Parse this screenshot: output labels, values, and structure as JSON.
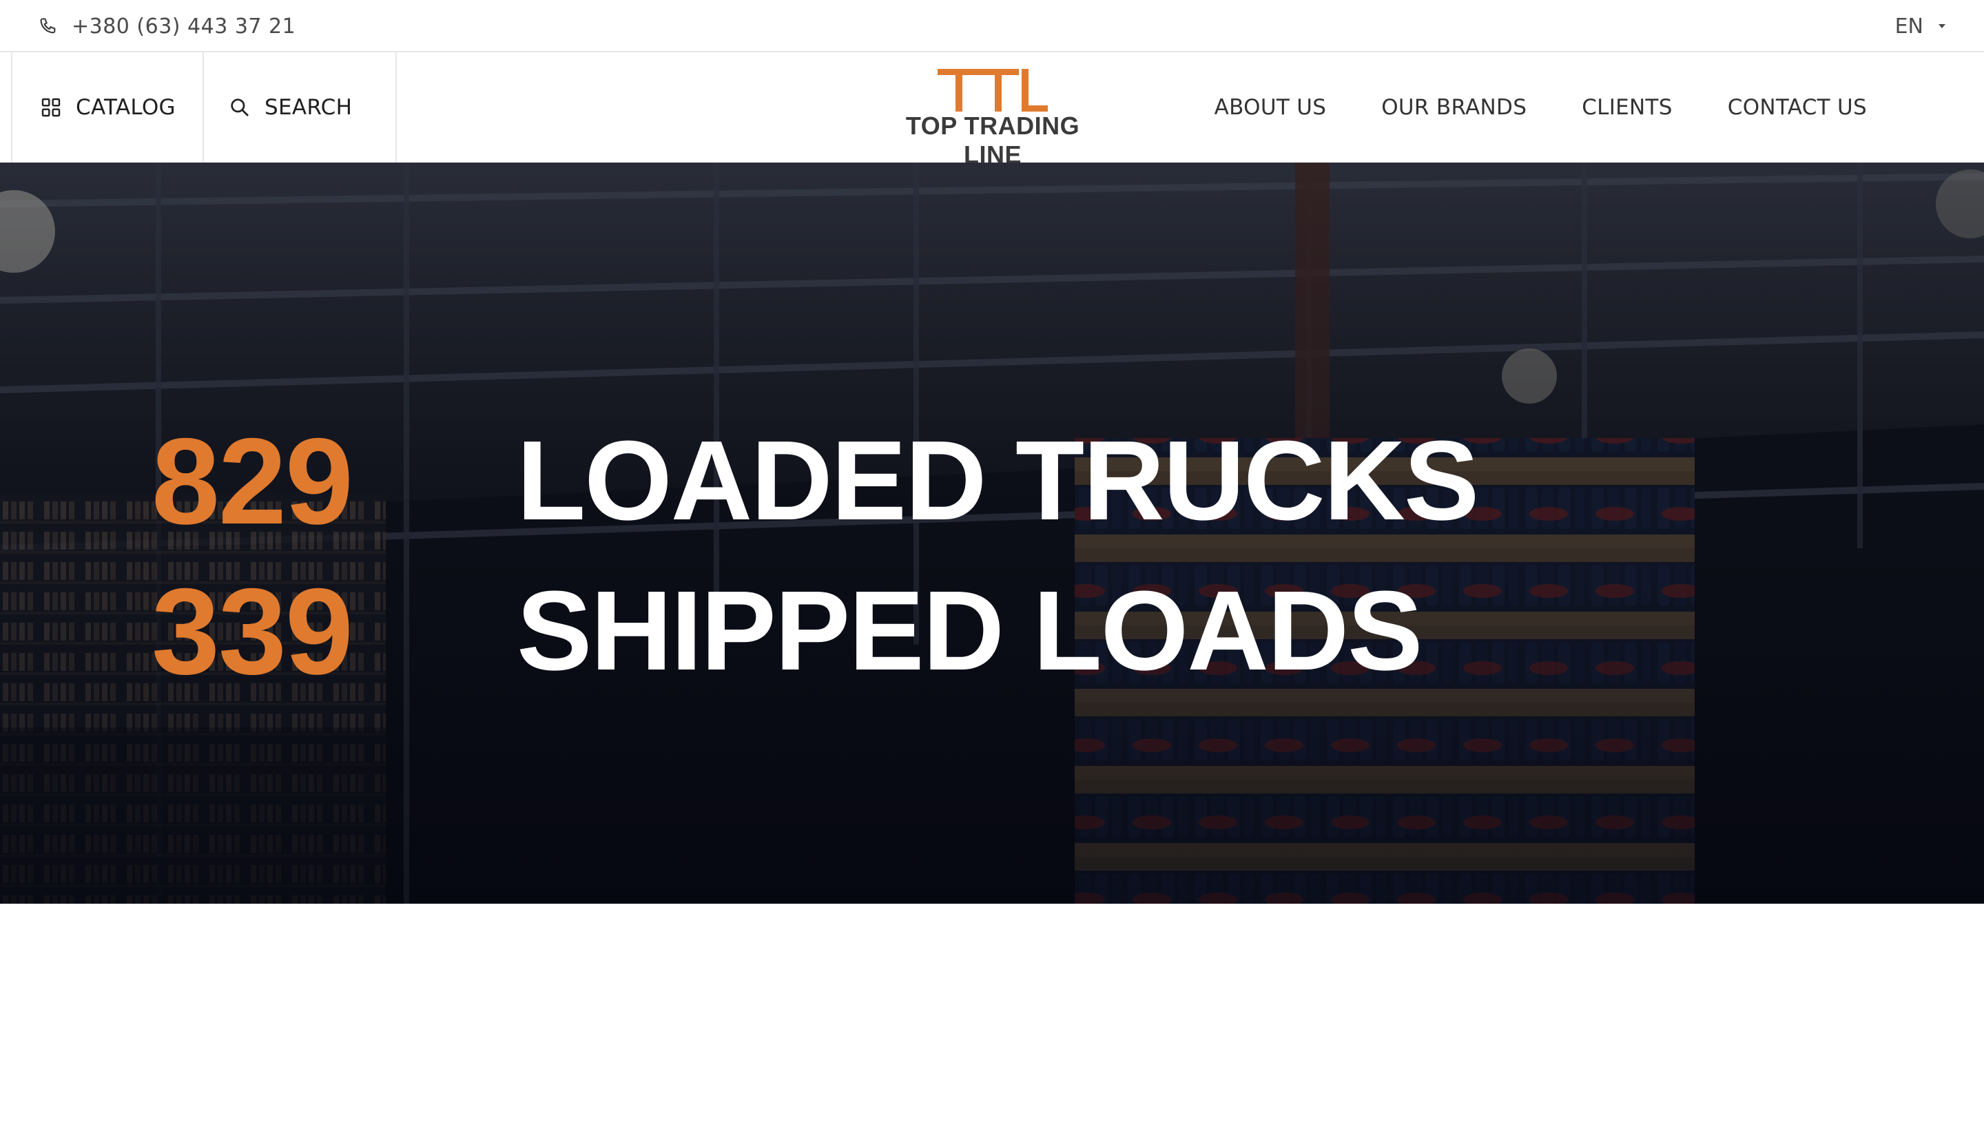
{
  "topbar": {
    "phone_icon": "phone-icon",
    "phone": "+380 (63) 443 37 21",
    "language": "EN"
  },
  "nav": {
    "catalog_label": "CATALOG",
    "catalog_icon": "grid-icon",
    "search_label": "SEARCH",
    "search_icon": "search-icon",
    "menu": [
      "ABOUT US",
      "OUR BRANDS",
      "CLIENTS",
      "CONTACT US"
    ]
  },
  "logo": {
    "mark": "TTL",
    "name": "TOP TRADING LINE"
  },
  "hero": {
    "stats": [
      {
        "value": "829",
        "label": "LOADED TRUCKS"
      },
      {
        "value": "339",
        "label": "SHIPPED LOADS"
      }
    ]
  },
  "colors": {
    "accent": "#e07a2e",
    "text_dark": "#2b2b2b",
    "hero_text": "#ffffff"
  }
}
